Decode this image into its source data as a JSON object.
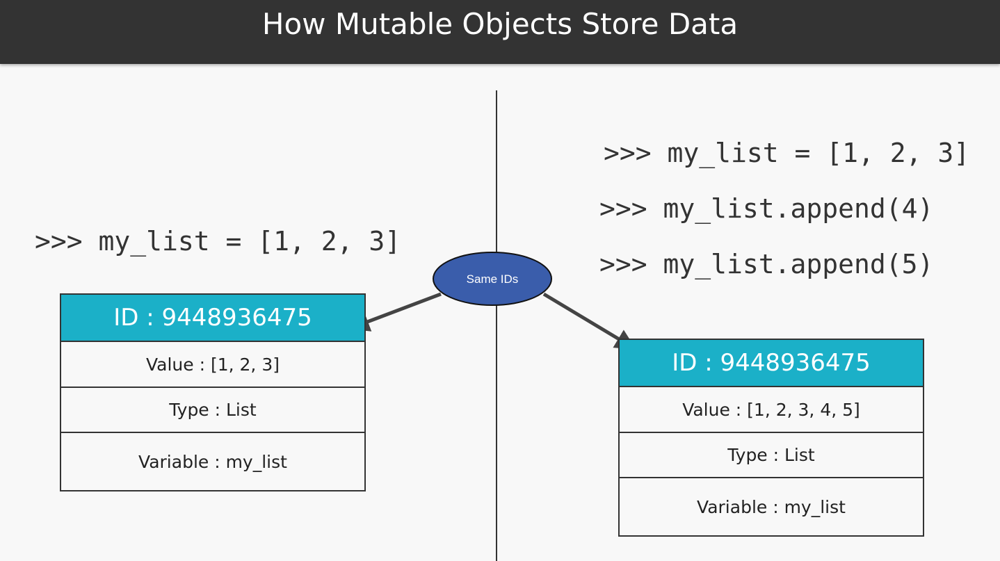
{
  "title": "How Mutable Objects Store Data",
  "left": {
    "code": ">>> my_list = [1, 2, 3]",
    "box": {
      "id": "ID : 9448936475",
      "value": "Value : [1, 2, 3]",
      "type": "Type : List",
      "variable": "Variable : my_list"
    }
  },
  "right": {
    "code": [
      ">>> my_list = [1, 2, 3]",
      ">>> my_list.append(4)",
      ">>> my_list.append(5)"
    ],
    "box": {
      "id": "ID : 9448936475",
      "value": "Value : [1, 2, 3, 4, 5]",
      "type": "Type : List",
      "variable": "Variable : my_list"
    }
  },
  "bubble": {
    "label": "Same IDs",
    "color": "#3a5dab"
  },
  "colors": {
    "header": "#1bb0c8",
    "titlebar": "#333333"
  }
}
